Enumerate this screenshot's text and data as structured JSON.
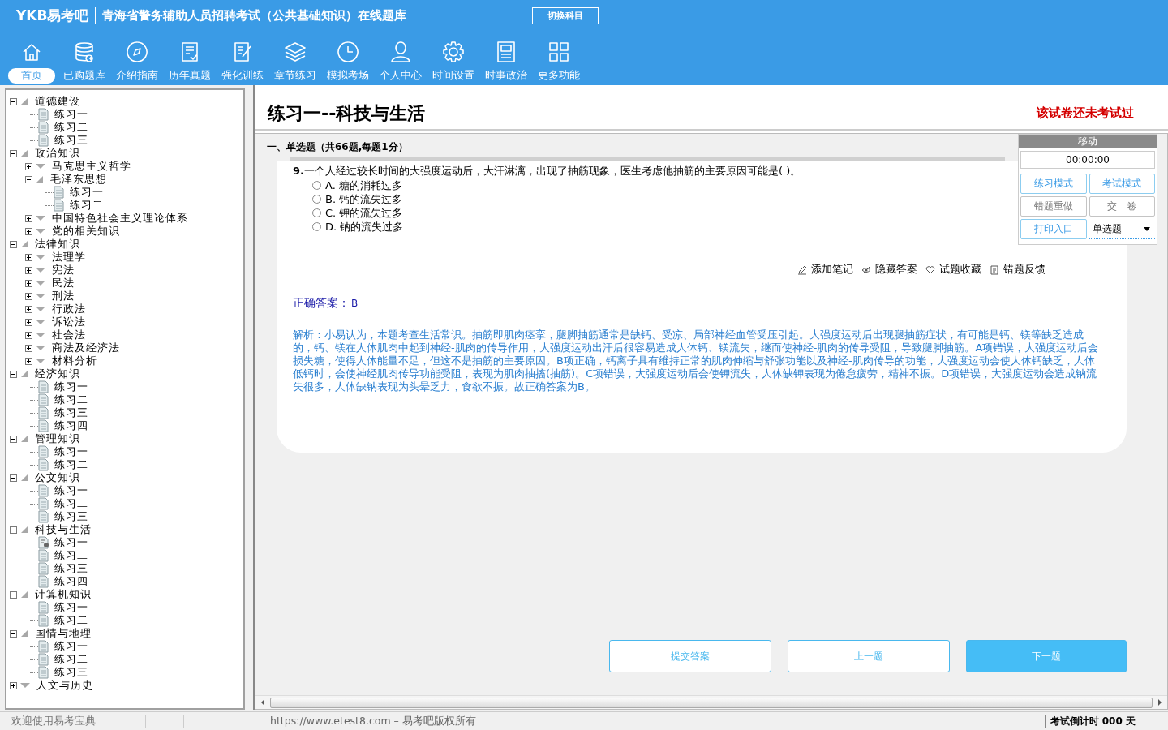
{
  "header": {
    "logo": "YKB易考吧",
    "title": "青海省警务辅助人员招聘考试（公共基础知识）在线题库",
    "switch_button": "切换科目"
  },
  "nav": [
    {
      "label": "首页",
      "selected": true
    },
    {
      "label": "已购题库",
      "selected": false
    },
    {
      "label": "介绍指南",
      "selected": false
    },
    {
      "label": "历年真题",
      "selected": false
    },
    {
      "label": "强化训练",
      "selected": false
    },
    {
      "label": "章节练习",
      "selected": false
    },
    {
      "label": "模拟考场",
      "selected": false
    },
    {
      "label": "个人中心",
      "selected": false
    },
    {
      "label": "时间设置",
      "selected": false
    },
    {
      "label": "时事政治",
      "selected": false
    },
    {
      "label": "更多功能",
      "selected": false
    }
  ],
  "tree": [
    {
      "label": "道德建设",
      "expanded": true,
      "children": [
        {
          "label": "练习一",
          "selected": false
        },
        {
          "label": "练习二",
          "selected": false
        },
        {
          "label": "练习三",
          "selected": false
        }
      ]
    },
    {
      "label": "政治知识",
      "expanded": true,
      "children": [
        {
          "label": "马克思主义哲学",
          "expanded": false
        },
        {
          "label": "毛泽东思想",
          "expanded": true,
          "children": [
            {
              "label": "练习一",
              "selected": false
            },
            {
              "label": "练习二",
              "selected": false
            }
          ]
        },
        {
          "label": "中国特色社会主义理论体系",
          "expanded": false
        },
        {
          "label": "党的相关知识",
          "expanded": false
        }
      ]
    },
    {
      "label": "法律知识",
      "expanded": true,
      "children": [
        {
          "label": "法理学",
          "expanded": false
        },
        {
          "label": "宪法",
          "expanded": false
        },
        {
          "label": "民法",
          "expanded": false
        },
        {
          "label": "刑法",
          "expanded": false
        },
        {
          "label": "行政法",
          "expanded": false
        },
        {
          "label": "诉讼法",
          "expanded": false
        },
        {
          "label": "社会法",
          "expanded": false
        },
        {
          "label": "商法及经济法",
          "expanded": false
        },
        {
          "label": "材料分析",
          "expanded": false
        }
      ]
    },
    {
      "label": "经济知识",
      "expanded": true,
      "children": [
        {
          "label": "练习一",
          "selected": false
        },
        {
          "label": "练习二",
          "selected": false
        },
        {
          "label": "练习三",
          "selected": false
        },
        {
          "label": "练习四",
          "selected": false
        }
      ]
    },
    {
      "label": "管理知识",
      "expanded": true,
      "children": [
        {
          "label": "练习一",
          "selected": false
        },
        {
          "label": "练习二",
          "selected": false
        }
      ]
    },
    {
      "label": "公文知识",
      "expanded": true,
      "children": [
        {
          "label": "练习一",
          "selected": false
        },
        {
          "label": "练习二",
          "selected": false
        },
        {
          "label": "练习三",
          "selected": false
        }
      ]
    },
    {
      "label": "科技与生活",
      "expanded": true,
      "children": [
        {
          "label": "练习一",
          "selected": true
        },
        {
          "label": "练习二",
          "selected": false
        },
        {
          "label": "练习三",
          "selected": false
        },
        {
          "label": "练习四",
          "selected": false
        }
      ]
    },
    {
      "label": "计算机知识",
      "expanded": true,
      "children": [
        {
          "label": "练习一",
          "selected": false
        },
        {
          "label": "练习二",
          "selected": false
        }
      ]
    },
    {
      "label": "国情与地理",
      "expanded": true,
      "children": [
        {
          "label": "练习一",
          "selected": false
        },
        {
          "label": "练习二",
          "selected": false
        },
        {
          "label": "练习三",
          "selected": false
        }
      ]
    },
    {
      "label": "人文与历史",
      "expanded": false
    }
  ],
  "paper": {
    "title": "练习一--科技与生活",
    "status": "该试卷还未考试过"
  },
  "section": "一、单选题（共66题,每题1分）",
  "question": {
    "number": "9.",
    "text": "一个人经过较长时间的大强度运动后，大汗淋漓，出现了抽筋现象，医生考虑他抽筋的主要原因可能是( )。",
    "options": [
      {
        "label": "A. 糖的消耗过多",
        "selected": false
      },
      {
        "label": "B. 钙的流失过多",
        "selected": false
      },
      {
        "label": "C. 钾的流失过多",
        "selected": false
      },
      {
        "label": "D. 钠的流失过多",
        "selected": false
      }
    ]
  },
  "actions": [
    "添加笔记",
    "隐藏答案",
    "试题收藏",
    "错题反馈"
  ],
  "answer": {
    "label": "正确答案：",
    "value": "B"
  },
  "analysis": "解析：小易认为，本题考查生活常识。抽筋即肌肉痉挛，腿脚抽筋通常是缺钙、受凉、局部神经血管受压引起。大强度运动后出现腿抽筋症状，有可能是钙、镁等缺乏造成的，钙、镁在人体肌肉中起到神经-肌肉的传导作用，大强度运动出汗后很容易造成人体钙、镁流失，继而使神经-肌肉的传导受阻，导致腿脚抽筋。A项错误，大强度运动后会损失糖，使得人体能量不足，但这不是抽筋的主要原因。B项正确，钙离子具有维持正常的肌肉伸缩与舒张功能以及神经-肌肉传导的功能，大强度运动会使人体钙缺乏，人体低钙时，会使神经肌肉传导功能受阻，表现为肌肉抽搐(抽筋)。C项错误，大强度运动后会使钾流失，人体缺钾表现为倦怠疲劳，精神不振。D项错误，大强度运动会造成钠流失很多，人体缺钠表现为头晕乏力，食欲不振。故正确答案为B。",
  "side_panel": {
    "title": "移动",
    "timer": "00:00:00",
    "buttons": [
      {
        "label": "练习模式",
        "disabled": false
      },
      {
        "label": "考试模式",
        "disabled": false
      },
      {
        "label": "错题重做",
        "disabled": true
      },
      {
        "label": "交　卷",
        "disabled": true
      },
      {
        "label": "打印入口",
        "disabled": false
      }
    ],
    "type_select": "单选题"
  },
  "bottom_buttons": [
    {
      "label": "提交答案",
      "primary": false
    },
    {
      "label": "上一题",
      "primary": false
    },
    {
      "label": "下一题",
      "primary": true
    }
  ],
  "status_bar": {
    "welcome": "欢迎使用易考宝典",
    "copyright": "https://www.etest8.com – 易考吧版权所有",
    "countdown": "考试倒计时 000 天"
  }
}
